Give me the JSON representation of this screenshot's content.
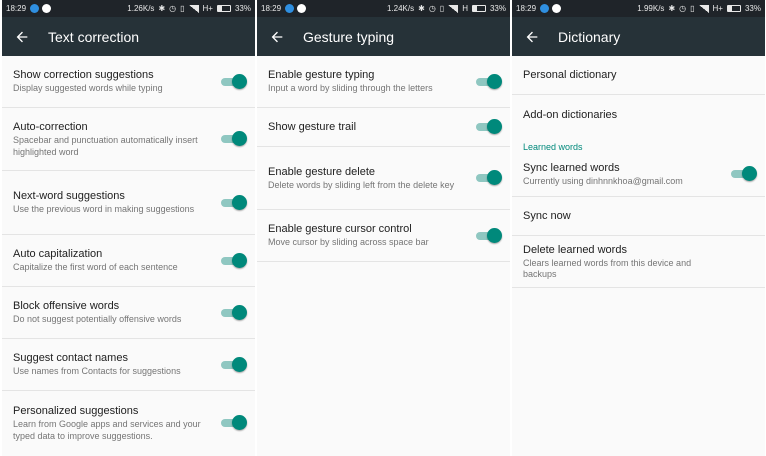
{
  "panels": [
    {
      "status": {
        "time": "18:29",
        "speed": "1.26K/s",
        "net": "H+",
        "battery": "33%"
      },
      "title": "Text correction",
      "items": [
        {
          "title": "Show correction suggestions",
          "subtitle": "Display suggested words while typing",
          "toggle_on": true
        },
        {
          "title": "Auto-correction",
          "subtitle": "Spacebar and punctuation automatically insert highlighted word",
          "toggle_on": true
        },
        {
          "title": "Next-word suggestions",
          "subtitle": "Use the previous word in making suggestions",
          "toggle_on": true
        },
        {
          "title": "Auto capitalization",
          "subtitle": "Capitalize the first word of each sentence",
          "toggle_on": true
        },
        {
          "title": "Block offensive words",
          "subtitle": "Do not suggest potentially offensive words",
          "toggle_on": true
        },
        {
          "title": "Suggest contact names",
          "subtitle": "Use names from Contacts for suggestions",
          "toggle_on": true
        },
        {
          "title": "Personalized suggestions",
          "subtitle": "Learn from Google apps and services and your typed data to improve suggestions.",
          "toggle_on": true
        }
      ]
    },
    {
      "status": {
        "time": "18:29",
        "speed": "1.24K/s",
        "net": "H",
        "battery": "33%"
      },
      "title": "Gesture typing",
      "items": [
        {
          "title": "Enable gesture typing",
          "subtitle": "Input a word by sliding through the letters",
          "toggle_on": true
        },
        {
          "title": "Show gesture trail",
          "subtitle": "",
          "toggle_on": true
        },
        {
          "title": "Enable gesture delete",
          "subtitle": "Delete words by sliding left from the delete key",
          "toggle_on": true
        },
        {
          "title": "Enable gesture cursor control",
          "subtitle": "Move cursor by sliding across space bar",
          "toggle_on": true
        }
      ]
    },
    {
      "status": {
        "time": "18:29",
        "speed": "1.99K/s",
        "net": "H+",
        "battery": "33%"
      },
      "title": "Dictionary",
      "items": [
        {
          "title": "Personal dictionary",
          "subtitle": ""
        },
        {
          "title": "Add-on dictionaries",
          "subtitle": ""
        }
      ],
      "section_header": "Learned words",
      "learned_items": [
        {
          "title": "Sync learned words",
          "subtitle": "Currently using dinhnnkhoa@gmail.com",
          "toggle_on": true
        },
        {
          "title": "Sync now",
          "subtitle": ""
        },
        {
          "title": "Delete learned words",
          "subtitle": "Clears learned words from this device and backups"
        }
      ]
    }
  ],
  "colors": {
    "toolbar": "#263238",
    "statusbar": "#1f2429",
    "accent": "#00897b"
  }
}
